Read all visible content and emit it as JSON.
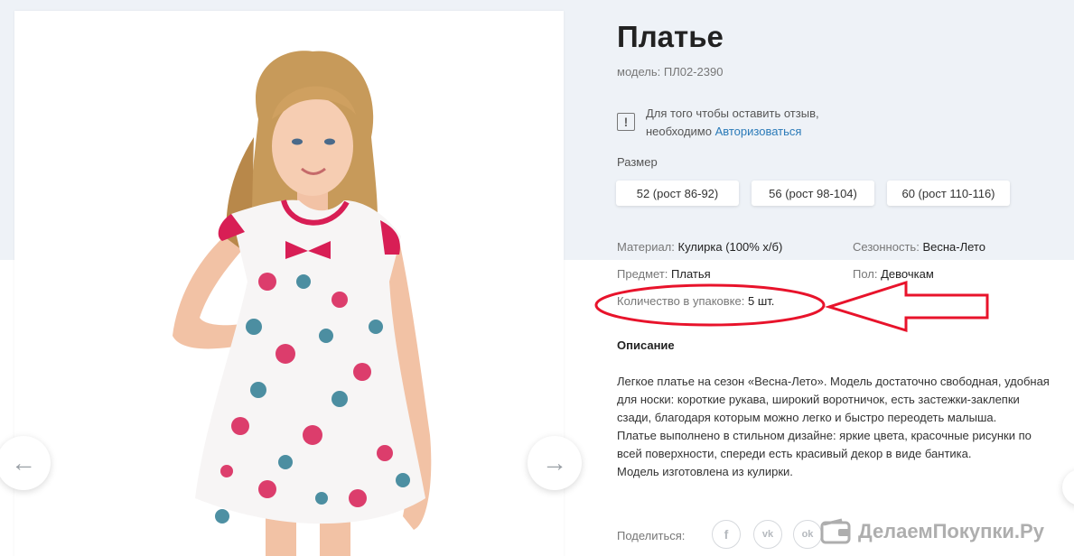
{
  "product": {
    "title": "Платье",
    "model": "модель: ПЛ02-2390"
  },
  "review": {
    "text_line1": "Для того чтобы оставить отзыв,",
    "text_line2_prefix": "необходимо ",
    "link_label": "Авторизоваться"
  },
  "sizes": {
    "label": "Размер",
    "options": [
      "52 (рост 86-92)",
      "56 (рост 98-104)",
      "60 (рост 110-116)"
    ]
  },
  "properties": {
    "material_key": "Материал:",
    "material_val": "Кулирка (100% х/б)",
    "season_key": "Сезонность:",
    "season_val": "Весна-Лето",
    "item_key": "Предмет:",
    "item_val": "Платья",
    "gender_key": "Пол:",
    "gender_val": "Девочкам",
    "pack_key": "Количество в упаковке:",
    "pack_val": "5 шт."
  },
  "description": {
    "title": "Описание",
    "lines": [
      "Легкое платье на сезон «Весна-Лето». Модель достаточно свободная, удобная",
      "для носки: короткие рукава, широкий воротничок, есть застежки-заклепки",
      "сзади, благодаря которым можно легко и быстро переодеть малыша.",
      "Платье выполнено в стильном дизайне: яркие цвета, красочные рисунки по",
      "всей поверхности, спереди есть красивый декор в виде бантика.",
      "Модель изготовлена из кулирки."
    ]
  },
  "share": {
    "label": "Поделиться:",
    "networks": [
      "f",
      "vk",
      "ok"
    ]
  },
  "gallery": {
    "prev_icon": "arrow-left-icon",
    "next_icon": "arrow-right-icon",
    "prev_glyph": "←",
    "next_glyph": "→"
  },
  "watermark": {
    "text": "ДелаемПокупки.Ру"
  },
  "colors": {
    "accent_link": "#2a7ab8",
    "annotation_red": "#e8132b",
    "dress_red": "#d81e55"
  }
}
